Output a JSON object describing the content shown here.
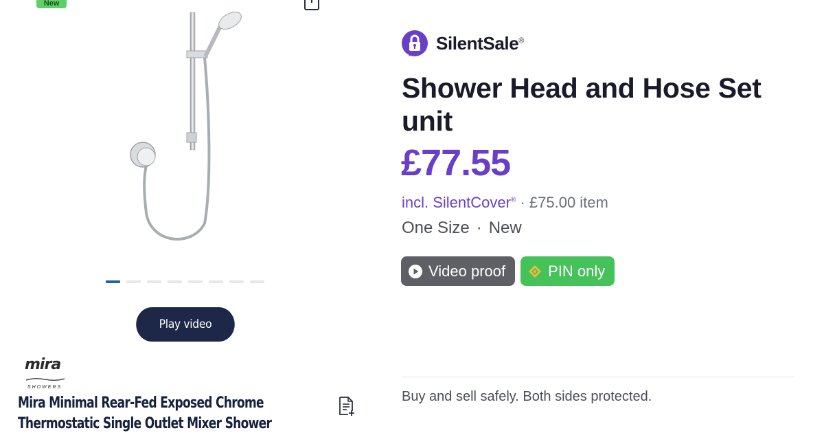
{
  "image": {
    "badge": "New",
    "carousel": {
      "count": 8,
      "active": 0
    },
    "play_label": "Play video"
  },
  "brand": {
    "logo_text": "mira",
    "logo_sub": "SHOWERS"
  },
  "product": {
    "title_line1": "Mira Minimal Rear-Fed Exposed Chrome",
    "title_line2": "Thermostatic Single Outlet Mixer Shower"
  },
  "seller": {
    "name": "SilentSale",
    "mark": "®"
  },
  "listing": {
    "title": "Shower Head and Hose Set unit",
    "price": "£77.55",
    "cover_label": "incl. SilentCover",
    "cover_mark": "®",
    "item_price": "· £75.00 item",
    "size": "One Size",
    "separator": "·",
    "condition": "New"
  },
  "tags": {
    "video_label": "Video proof",
    "pin_label": "PIN only"
  },
  "footer": {
    "safety_text": "Buy and sell safely. Both sides protected."
  },
  "colors": {
    "accent": "#6a3fc8",
    "navy": "#1d2747",
    "green": "#46c25a",
    "gray_tag": "#5f5f66"
  }
}
